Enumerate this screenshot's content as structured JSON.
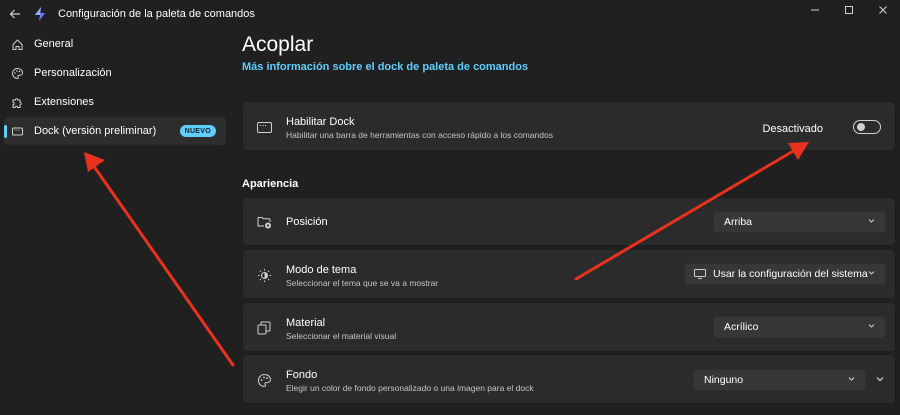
{
  "window": {
    "title": "Configuración de la paleta de comandos",
    "back_icon": "back-arrow-icon",
    "controls": [
      "minimize-icon",
      "maximize-icon",
      "close-icon"
    ]
  },
  "sidebar": {
    "items": [
      {
        "label": "General",
        "icon": "home-icon"
      },
      {
        "label": "Personalización",
        "icon": "palette-icon"
      },
      {
        "label": "Extensiones",
        "icon": "puzzle-icon"
      },
      {
        "label": "Dock (versión preliminar)",
        "icon": "dock-icon",
        "badge": "NUEVO",
        "selected": true
      }
    ]
  },
  "main": {
    "title": "Acoplar",
    "more_link": "Más información sobre el dock de paleta de comandos",
    "dock_card": {
      "title": "Habilitar Dock",
      "subtitle": "Habilitar una barra de herramientas con acceso rápido a los comandos",
      "toggle_label": "Desactivado",
      "toggle_on": false
    },
    "section_label": "Apariencia",
    "settings": [
      {
        "title": "Posición",
        "subtitle": "",
        "value": "Arriba",
        "icon": "folder-settings-icon"
      },
      {
        "title": "Modo de tema",
        "subtitle": "Seleccionar el tema que se va a mostrar",
        "value": "Usar la configuración del sistema",
        "icon": "brightness-icon"
      },
      {
        "title": "Material",
        "subtitle": "Seleccionar el material visual",
        "value": "Acrílico",
        "icon": "layers-icon"
      },
      {
        "title": "Fondo",
        "subtitle": "Elegir un color de fondo personalizado o una imagen para el dock",
        "value": "Ninguno",
        "icon": "palette-icon"
      }
    ]
  },
  "colors": {
    "background": "#202020",
    "card": "#2b2b2b",
    "accent": "#60cdff",
    "annotation_arrow": "#e8321e"
  }
}
